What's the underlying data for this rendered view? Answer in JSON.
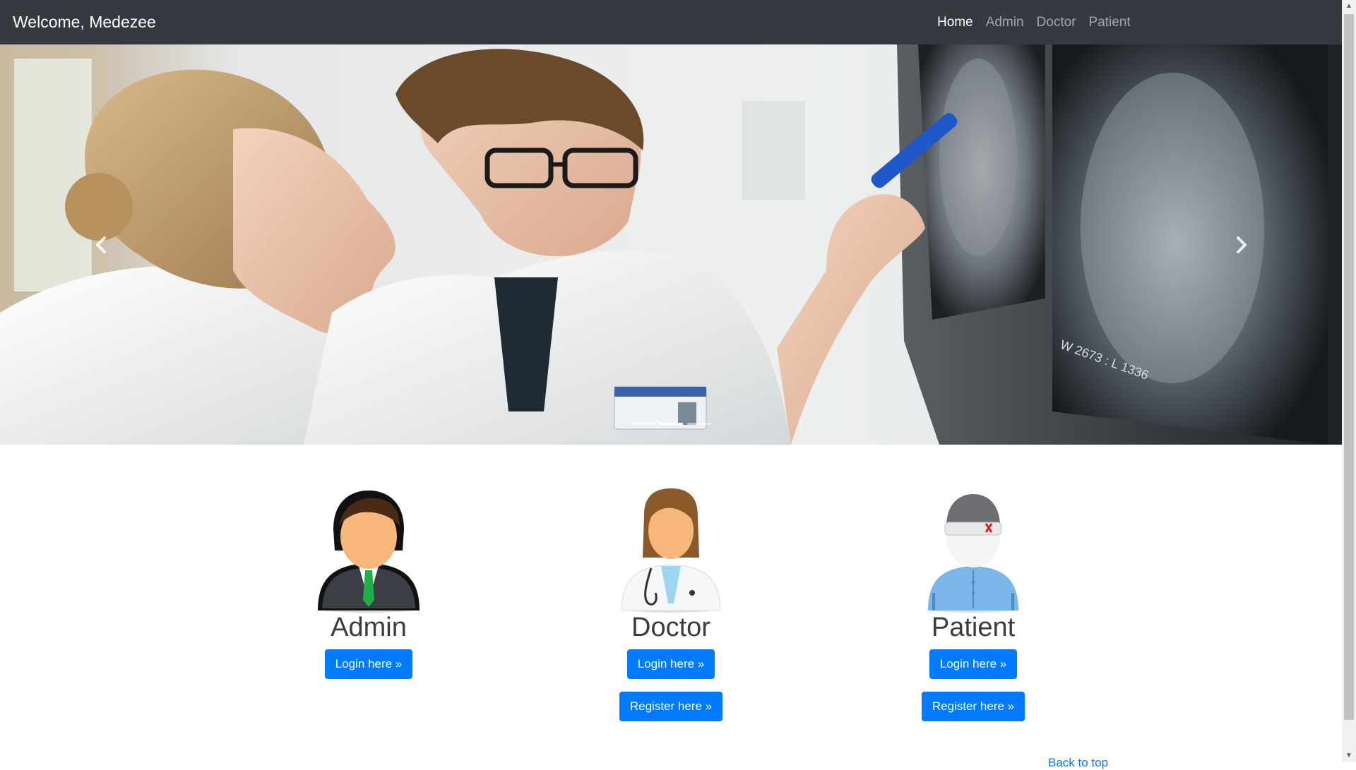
{
  "navbar": {
    "brand": "Welcome, Medezee",
    "links": [
      {
        "label": "Home",
        "active": true
      },
      {
        "label": "Admin",
        "active": false
      },
      {
        "label": "Doctor",
        "active": false
      },
      {
        "label": "Patient",
        "active": false
      }
    ]
  },
  "carousel": {
    "slides": 3,
    "active_slide": 2,
    "prev_icon": "chevron-left-icon",
    "next_icon": "chevron-right-icon",
    "image_text": "W 2673 : L 1336"
  },
  "roles": [
    {
      "title": "Admin",
      "login_label": "Login here »",
      "icon": "admin-avatar-icon"
    },
    {
      "title": "Doctor",
      "login_label": "Login here »",
      "register_label": "Register here »",
      "icon": "doctor-avatar-icon"
    },
    {
      "title": "Patient",
      "login_label": "Login here »",
      "register_label": "Register here »",
      "icon": "patient-avatar-icon"
    }
  ],
  "footer": {
    "back_to_top": "Back to top"
  },
  "colors": {
    "navbar_bg": "#343a40",
    "primary": "#007bff",
    "nav_inactive": "rgba(255,255,255,0.55)",
    "nav_active": "#ffffff"
  }
}
